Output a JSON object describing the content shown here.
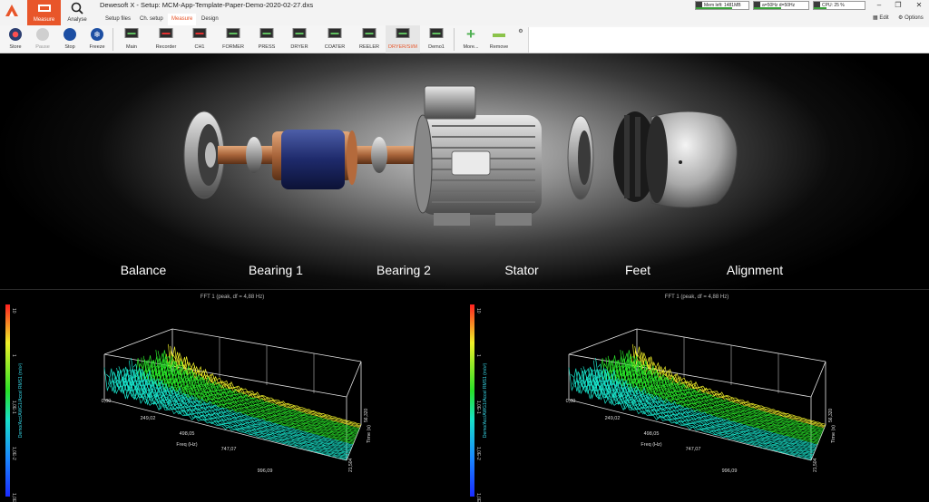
{
  "app": {
    "title": "Dewesoft X - Setup: MCM-App-Template-Paper-Demo-2020-02-27.dxs",
    "modes": [
      {
        "label": "Measure",
        "active": true
      },
      {
        "label": "Analyse",
        "active": false
      }
    ],
    "subtabs": [
      "Setup files",
      "Ch. setup",
      "Measure",
      "Design"
    ],
    "monitors": {
      "memory": "Mem left: 1481MB",
      "sync": "a=50Hz d=50Hz",
      "cpu": "CPU: 25 %"
    },
    "right_tools": {
      "edit": "Edit",
      "options": "Options"
    }
  },
  "toolbar": {
    "actions": [
      "Store",
      "Pause",
      "Stop",
      "Freeze"
    ],
    "screens": [
      "Main",
      "Recorder",
      "CH1",
      "FORMER",
      "PRESS",
      "DRYER",
      "COATER",
      "REELER",
      "DRYER/SI/M",
      "Demo1"
    ],
    "active_screen": "DRYER/SI/M",
    "more": "More...",
    "remove": "Remove"
  },
  "hero": {
    "labels": [
      "Balance",
      "Bearing 1",
      "Bearing 2",
      "Stator",
      "Feet",
      "Alignment"
    ]
  },
  "chart_data": [
    {
      "type": "waterfall",
      "title": "FFT 1 (peak, df = 4,88 Hz)",
      "xlabel": "Freq (Hz)",
      "ylabel": "Time (s)",
      "zlabel": "Demo/Acc/AWG1/Accel RMS1 (m/s²)",
      "x_ticks": [
        "0,00",
        "249,02",
        "498,05",
        "747,07",
        "996,09"
      ],
      "y_ticks": [
        "56,320",
        "21,504"
      ],
      "colorbar_ticks": [
        "10",
        "1",
        "1,0E-1",
        "1,0E-2",
        "1,0E-3"
      ],
      "scale": "log"
    },
    {
      "type": "waterfall",
      "title": "FFT 1 (peak, df = 4,88 Hz)",
      "xlabel": "Freq (Hz)",
      "ylabel": "Time (s)",
      "zlabel": "Demo/Acc/AWG1/Accel RMS1 (m/s²)",
      "x_ticks": [
        "0,00",
        "249,02",
        "498,05",
        "747,07",
        "996,09"
      ],
      "y_ticks": [
        "56,320",
        "21,504"
      ],
      "colorbar_ticks": [
        "10",
        "1",
        "1,0E-1",
        "1,0E-2",
        "1,0E-3"
      ],
      "scale": "log"
    }
  ],
  "colors": {
    "accent": "#e8562a",
    "toolbar": "#f5f5f5",
    "background": "#000000"
  }
}
